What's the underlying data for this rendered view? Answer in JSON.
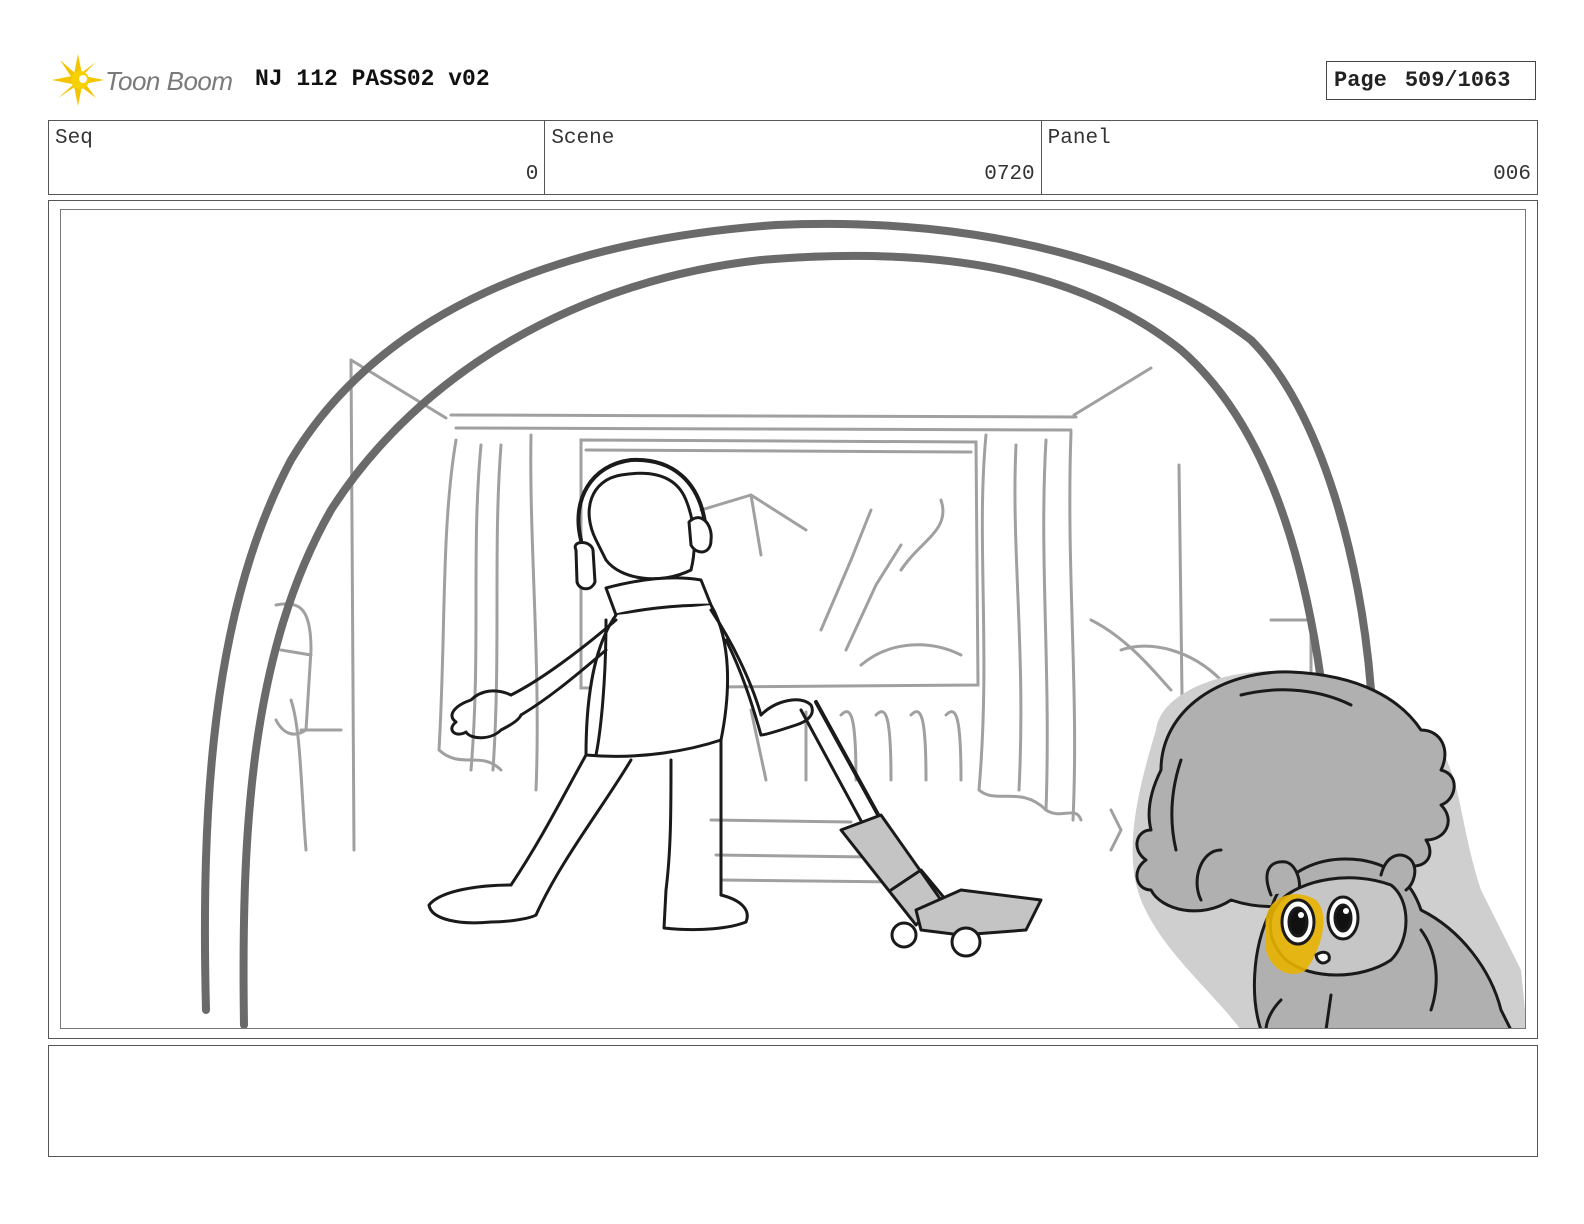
{
  "header": {
    "logo_text": "Toon Boom",
    "project_title": "NJ 112 PASS02 v02",
    "page_label": "Page",
    "page_value": "509/1063"
  },
  "meta": {
    "seq_label": "Seq",
    "seq_value": "0",
    "scene_label": "Scene",
    "scene_value": "0720",
    "panel_label": "Panel",
    "panel_value": "006"
  },
  "notes": {
    "text": ""
  },
  "icons": {
    "logo": "toon-boom-starburst-icon"
  },
  "colors": {
    "logo_yellow": "#f5c400",
    "sketch_line": "#222222",
    "background_line": "#9a9a9a",
    "character_fill": "#b0b0b0",
    "eye_highlight": "#e8b200"
  }
}
